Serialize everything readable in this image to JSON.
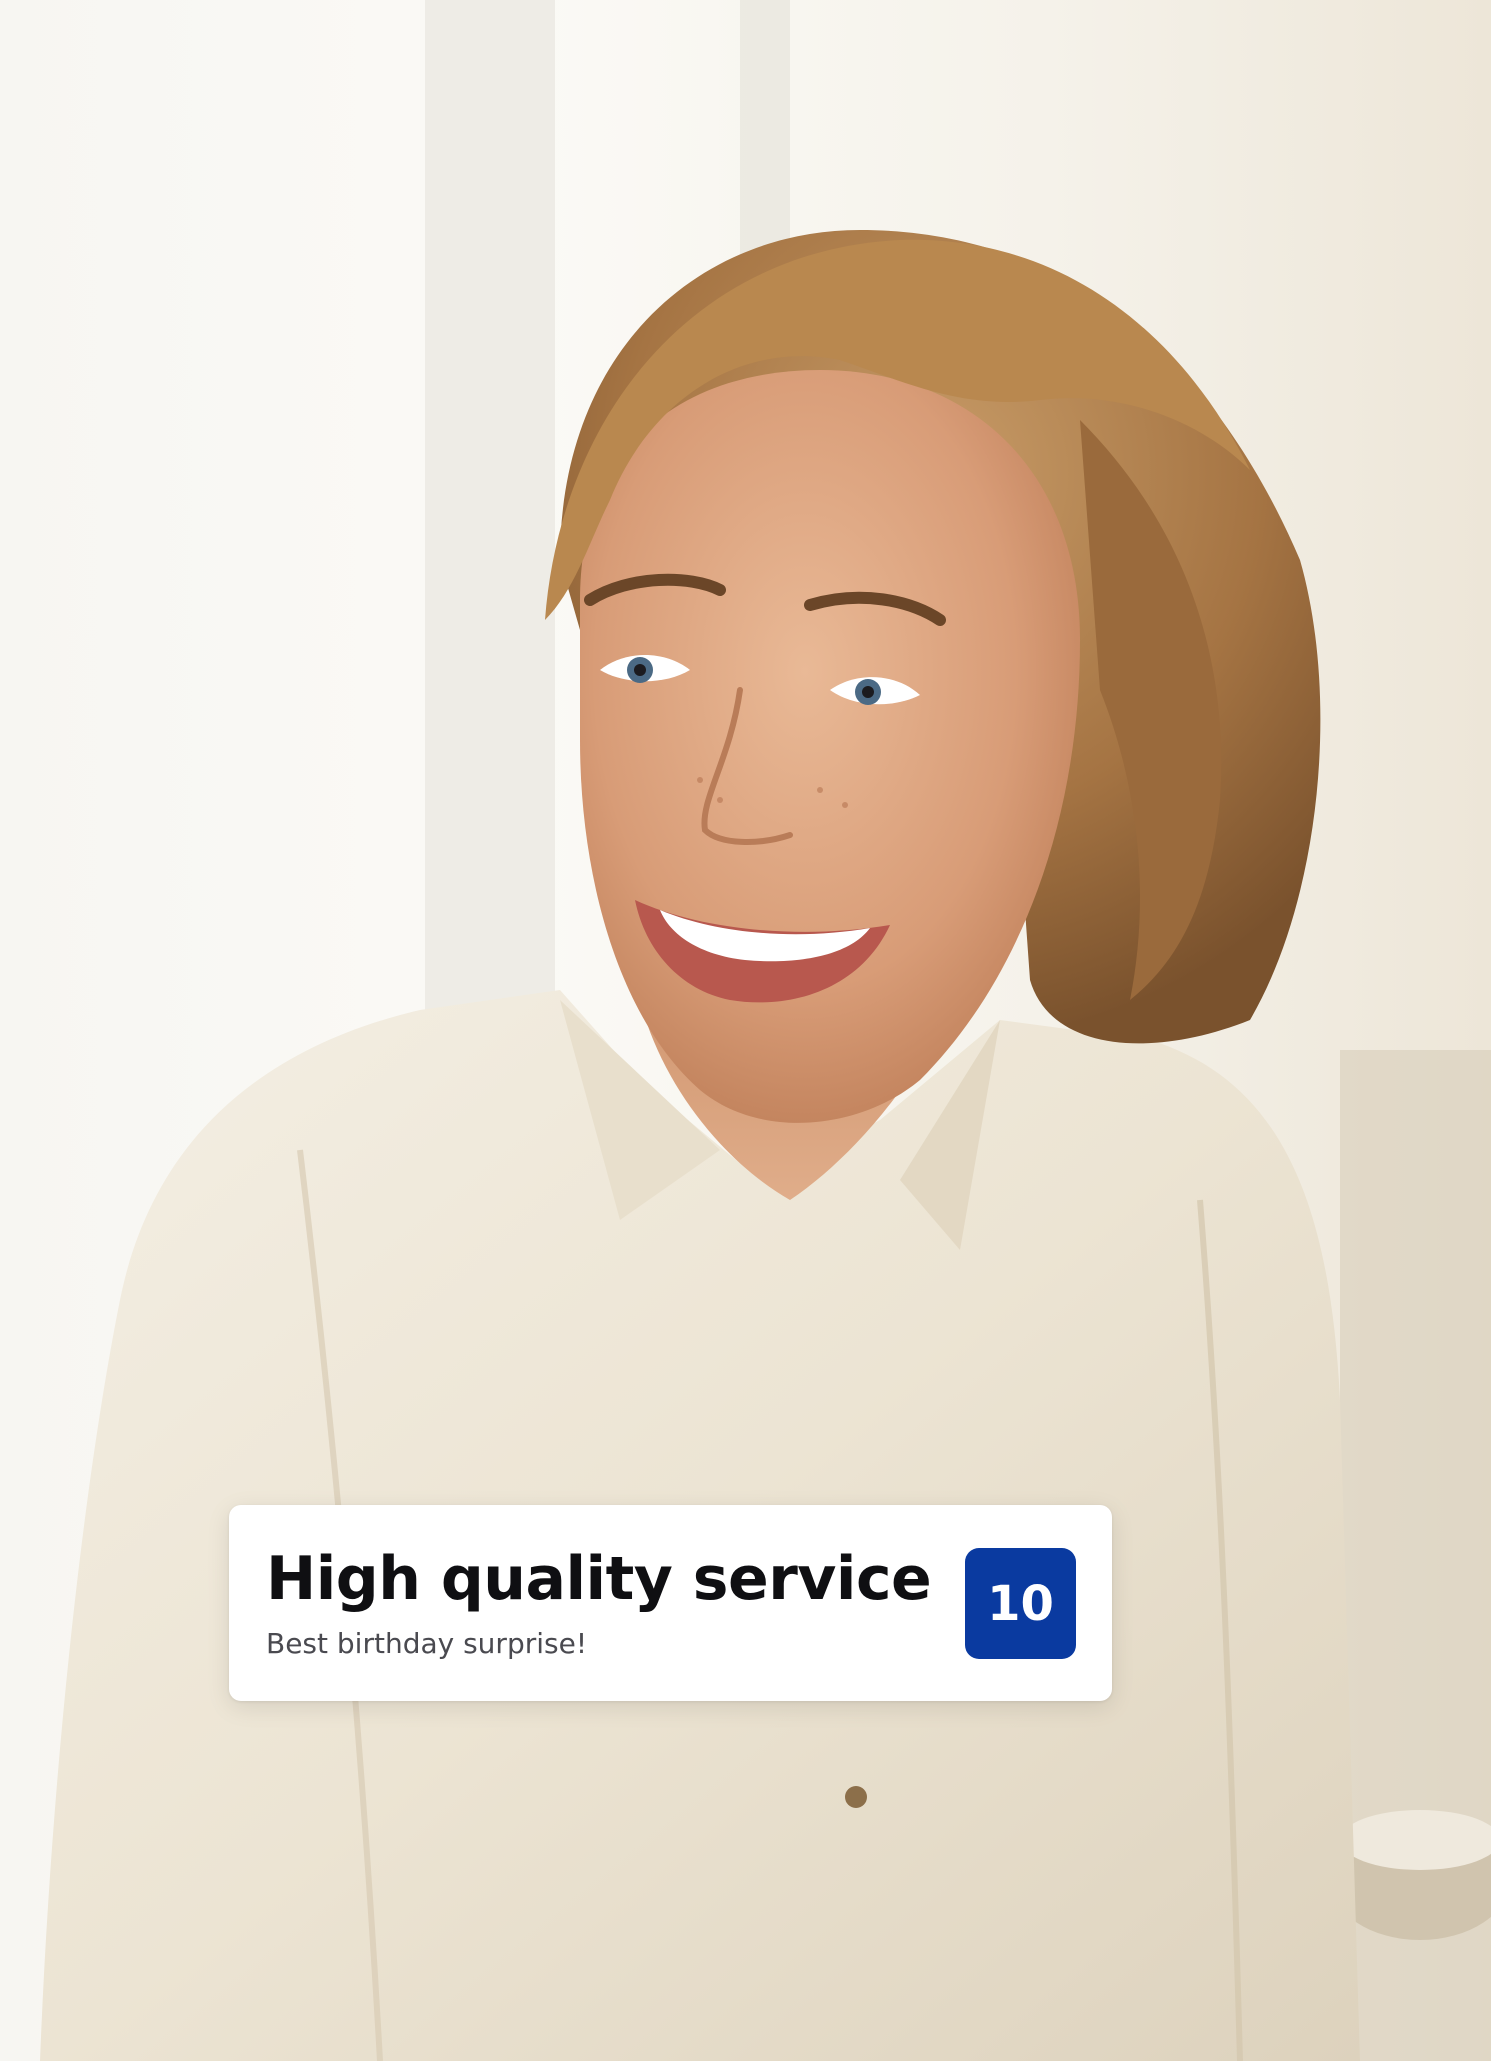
{
  "review": {
    "title": "High quality service",
    "subtitle": "Best birthday surprise!",
    "score": "10"
  },
  "colors": {
    "badge": "#0a3aa0",
    "card_background": "#ffffff",
    "title_text": "#0f0f12",
    "subtitle_text": "#4a4a50"
  }
}
